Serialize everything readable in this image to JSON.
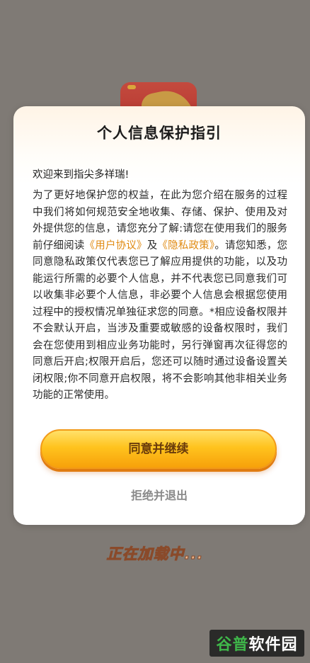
{
  "dialog": {
    "title": "个人信息保护指引",
    "welcome": "欢迎来到指尖多祥瑞!",
    "body_part1": "为了更好地保护您的权益，在此为您介绍在服务的过程中我们将如何规范安全地收集、存储、保护、使用及对外提供您的信息，请您充分了解:请您在使用我们的服务前仔细阅读",
    "link_user_agreement": "《用户协议》",
    "body_and": "及",
    "link_privacy_policy": "《隐私政策》",
    "body_part2": "。请您知悉，您同意隐私政策仅代表您已了解应用提供的功能，以及功能运行所需的必要个人信息，并不代表您已同意我们可以收集非必要个人信息，非必要个人信息会根据您使用过程中的授权情况单独征求您的同意。*相应设备权限并不会默认开启，当涉及重要或敏感的设备权限时，我们会在您使用到相应业务功能时，另行弹窗再次征得您的同意后开启;权限开启后，您还可以随时通过设备设置关闭权限;你不同意开启权限，将不会影响其他非相关业务功能的正常使用。",
    "agree_label": "同意并继续",
    "reject_label": "拒绝并退出"
  },
  "loading_text": "正在加载中...",
  "watermark": {
    "part1": "谷普",
    "part2": "软件园"
  },
  "colors": {
    "backdrop": "#7f7a75",
    "link": "#e08a11",
    "button_top": "#ffe16a",
    "button_bottom": "#f7a10a",
    "button_text": "#6a3b0b"
  }
}
